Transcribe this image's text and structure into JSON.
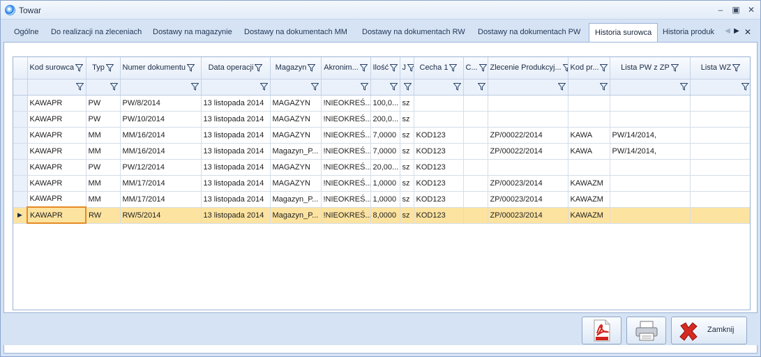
{
  "window": {
    "title": "Towar"
  },
  "tabs": [
    {
      "label": "Ogólne"
    },
    {
      "label": "Do realizacji na zleceniach"
    },
    {
      "label": "Dostawy na magazynie"
    },
    {
      "label": "Dostawy na dokumentach MM"
    },
    {
      "label": "Dostawy na dokumentach RW"
    },
    {
      "label": "Dostawy na dokumentach PW"
    },
    {
      "label": "Historia surowca",
      "active": true
    },
    {
      "label": "Historia produk"
    }
  ],
  "grid": {
    "columns": [
      "Kod surowca",
      "Typ",
      "Numer dokumentu",
      "Data operacji",
      "Magazyn",
      "Akronim...",
      "Ilość",
      "J",
      "Cecha 1",
      "C...",
      "Zlecenie Produkcyj...",
      "Kod pr...",
      "Lista PW z ZP",
      "Lista WZ"
    ],
    "rows": [
      [
        "KAWAPR",
        "PW",
        "PW/8/2014",
        "13 listopada 2014",
        "MAGAZYN",
        "!NIEOKREŚ...",
        "100,0...",
        "sz",
        "",
        "",
        "",
        "",
        "",
        ""
      ],
      [
        "KAWAPR",
        "PW",
        "PW/10/2014",
        "13 listopada 2014",
        "MAGAZYN",
        "!NIEOKREŚ...",
        "200,0...",
        "sz",
        "",
        "",
        "",
        "",
        "",
        ""
      ],
      [
        "KAWAPR",
        "MM",
        "MM/16/2014",
        "13 listopada 2014",
        "MAGAZYN",
        "!NIEOKREŚ...",
        "7,0000",
        "sz",
        "KOD123",
        "",
        "ZP/00022/2014",
        "KAWA",
        "PW/14/2014,",
        ""
      ],
      [
        "KAWAPR",
        "MM",
        "MM/16/2014",
        "13 listopada 2014",
        "Magazyn_P...",
        "!NIEOKREŚ...",
        "7,0000",
        "sz",
        "KOD123",
        "",
        "ZP/00022/2014",
        "KAWA",
        "PW/14/2014,",
        ""
      ],
      [
        "KAWAPR",
        "PW",
        "PW/12/2014",
        "13 listopada 2014",
        "MAGAZYN",
        "!NIEOKREŚ...",
        "20,00...",
        "sz",
        "KOD123",
        "",
        "",
        "",
        "",
        ""
      ],
      [
        "KAWAPR",
        "MM",
        "MM/17/2014",
        "13 listopada 2014",
        "MAGAZYN",
        "!NIEOKREŚ...",
        "1,0000",
        "sz",
        "KOD123",
        "",
        "ZP/00023/2014",
        "KAWAZM",
        "",
        ""
      ],
      [
        "KAWAPR",
        "MM",
        "MM/17/2014",
        "13 listopada 2014",
        "Magazyn_P...",
        "!NIEOKREŚ...",
        "1,0000",
        "sz",
        "KOD123",
        "",
        "ZP/00023/2014",
        "KAWAZM",
        "",
        ""
      ],
      [
        "KAWAPR",
        "RW",
        "RW/5/2014",
        "13 listopada 2014",
        "Magazyn_P...",
        "!NIEOKREŚ...",
        "8,0000",
        "sz",
        "KOD123",
        "",
        "ZP/00023/2014",
        "KAWAZM",
        "",
        ""
      ]
    ],
    "selected_row": 7
  },
  "footer": {
    "close_label": "Zamknij"
  },
  "colors": {
    "accent": "#fde3a0",
    "focus_border": "#e58a25",
    "frame": "#d6e3f4"
  }
}
